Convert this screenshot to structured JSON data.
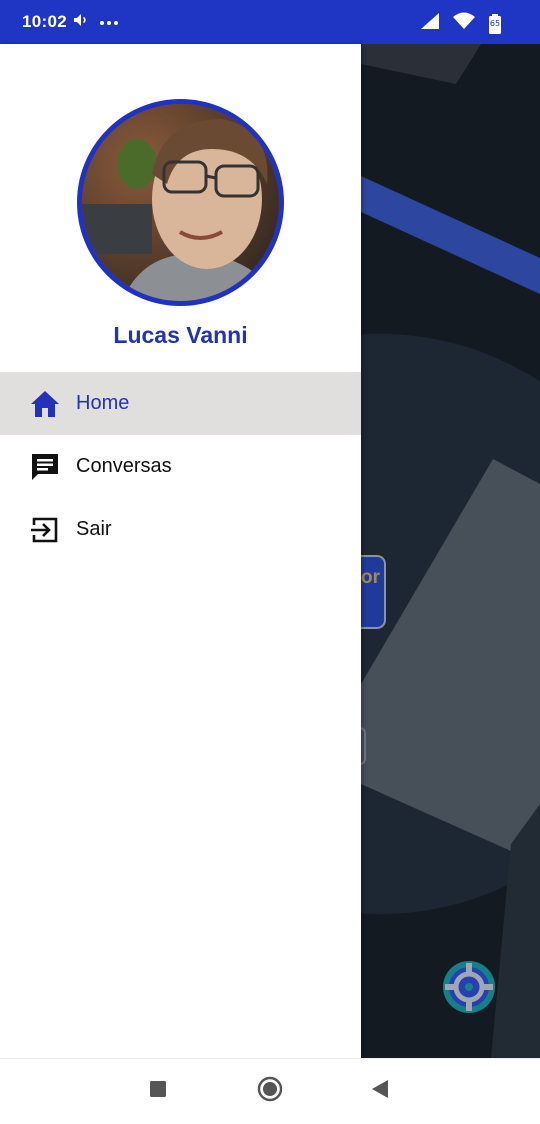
{
  "status_bar": {
    "time": "10:02",
    "battery_level": "65",
    "icons": [
      "volume-icon",
      "more-dots-icon",
      "cell-signal-icon",
      "wifi-icon",
      "battery-icon"
    ]
  },
  "drawer": {
    "user_name": "Lucas Vanni",
    "items": [
      {
        "label": "Home",
        "icon": "home-icon",
        "active": true
      },
      {
        "label": "Conversas",
        "icon": "chat-icon",
        "active": false
      },
      {
        "label": "Sair",
        "icon": "exit-icon",
        "active": false
      }
    ]
  },
  "background_app": {
    "partial_button_text": "or"
  },
  "colors": {
    "primary": "#1f35c4",
    "accent_text": "#2233b8",
    "active_item_bg": "#e1dede",
    "background_app": "#141a22"
  },
  "nav_bar": {
    "buttons": [
      "recents-button",
      "home-button",
      "back-button"
    ]
  }
}
